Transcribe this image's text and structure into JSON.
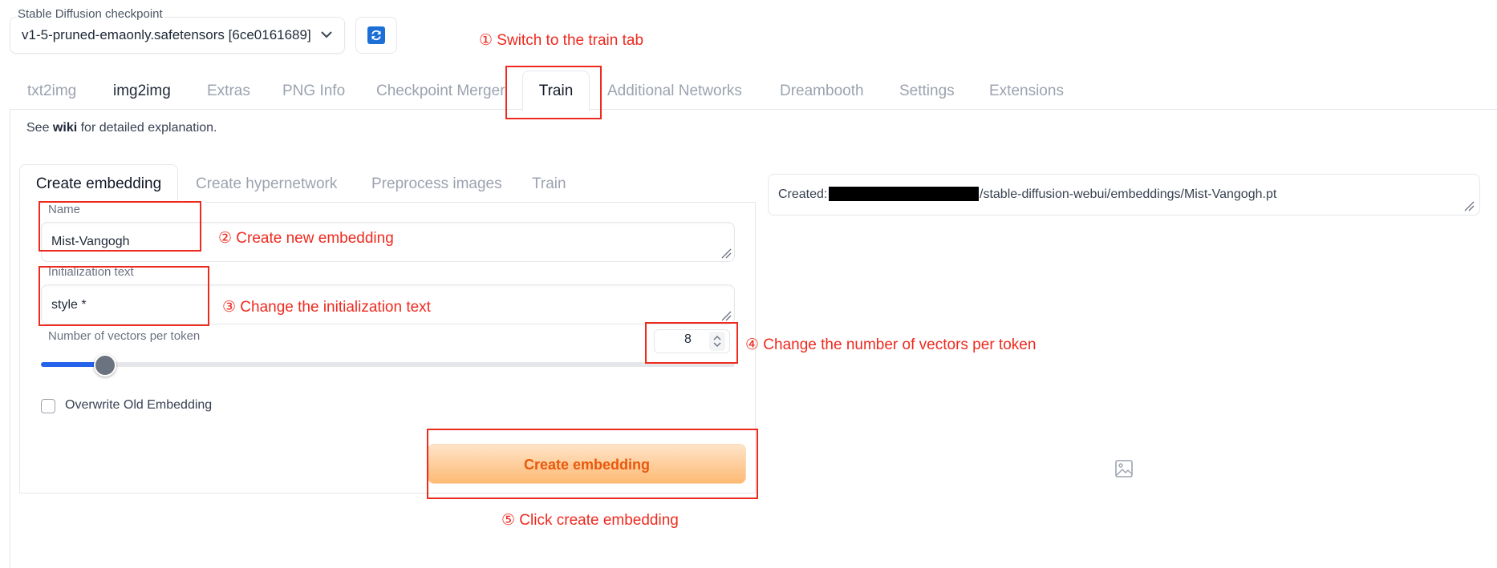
{
  "checkpoint": {
    "label": "Stable Diffusion checkpoint",
    "value": "v1-5-pruned-emaonly.safetensors [6ce0161689]",
    "refresh_icon": "refresh-icon",
    "dropdown_icon": "chevron-down-icon"
  },
  "main_tabs": [
    {
      "label": "txt2img"
    },
    {
      "label": "img2img"
    },
    {
      "label": "Extras"
    },
    {
      "label": "PNG Info"
    },
    {
      "label": "Checkpoint Merger"
    },
    {
      "label": "Train"
    },
    {
      "label": "Additional Networks"
    },
    {
      "label": "Dreambooth"
    },
    {
      "label": "Settings"
    },
    {
      "label": "Extensions"
    }
  ],
  "active_main_tab": "Train",
  "hint": {
    "prefix": "See ",
    "link": "wiki",
    "suffix": " for detailed explanation."
  },
  "sub_tabs": [
    {
      "label": "Create embedding"
    },
    {
      "label": "Create hypernetwork"
    },
    {
      "label": "Preprocess images"
    },
    {
      "label": "Train"
    }
  ],
  "form": {
    "name_label": "Name",
    "name_value": "Mist-Vangogh",
    "init_label": "Initialization text",
    "init_value": "style *",
    "vectors_label": "Number of vectors per token",
    "vectors_value": "8",
    "vectors_slider_fraction": 0.09,
    "overwrite_label": "Overwrite Old Embedding",
    "overwrite_checked": false,
    "create_button": "Create embedding"
  },
  "result": {
    "prefix": "Created: ",
    "path": "/stable-diffusion-webui/embeddings/Mist-Vangogh.pt",
    "image_icon": "image-placeholder-icon"
  },
  "annotations": [
    {
      "text": "① Switch to  the train tab"
    },
    {
      "text": "② Create new embedding"
    },
    {
      "text": "③ Change the initialization text"
    },
    {
      "text": "④ Change the number of vectors per token"
    },
    {
      "text": "⑤ Click create embedding"
    }
  ],
  "colors": {
    "annotation": "#ee2a1f",
    "accent": "#2563eb",
    "button_text": "#ea580c",
    "button_bg": "#fdba74"
  }
}
